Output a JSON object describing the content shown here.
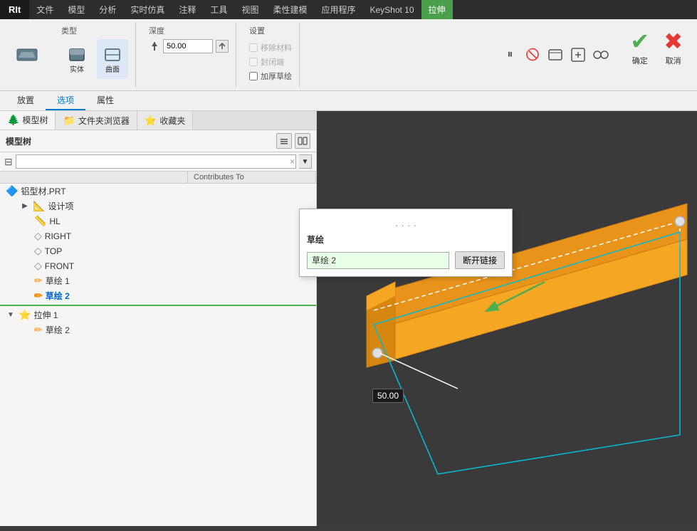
{
  "app": {
    "title": "RIt"
  },
  "menubar": {
    "items": [
      {
        "label": "文件",
        "active": false
      },
      {
        "label": "模型",
        "active": false
      },
      {
        "label": "分析",
        "active": false
      },
      {
        "label": "实时仿真",
        "active": false
      },
      {
        "label": "注释",
        "active": false
      },
      {
        "label": "工具",
        "active": false
      },
      {
        "label": "视图",
        "active": false
      },
      {
        "label": "柔性建模",
        "active": false
      },
      {
        "label": "应用程序",
        "active": false
      },
      {
        "label": "KeyShot 10",
        "active": false
      },
      {
        "label": "拉伸",
        "active": true,
        "highlight": true
      }
    ]
  },
  "ribbon": {
    "type_label": "类型",
    "depth_label": "深度",
    "settings_label": "设置",
    "solid_label": "实体",
    "surface_label": "曲面",
    "depth_value": "50.00",
    "remove_material_label": "移除材料",
    "close_ends_label": "封闭端",
    "thicken_sketch_label": "加厚草绘",
    "confirm_label": "确定",
    "cancel_label": "取消"
  },
  "subtabs": {
    "items": [
      {
        "label": "放置",
        "active": false
      },
      {
        "label": "选项",
        "active": true
      },
      {
        "label": "属性",
        "active": false
      }
    ]
  },
  "panel_tabs": [
    {
      "label": "模型树",
      "icon": "🌲",
      "active": true
    },
    {
      "label": "文件夹浏览器",
      "icon": "📁",
      "active": false
    },
    {
      "label": "收藏夹",
      "icon": "⭐",
      "active": false
    }
  ],
  "model_tree": {
    "title": "模型树",
    "search_placeholder": "",
    "contributes_to_label": "Contributes To",
    "items": [
      {
        "level": 0,
        "icon": "🔷",
        "label": "铝型材.PRT",
        "expandable": false
      },
      {
        "level": 1,
        "icon": "📐",
        "label": "设计项",
        "expandable": true
      },
      {
        "level": 1,
        "icon": "📏",
        "label": "HL",
        "expandable": false
      },
      {
        "level": 1,
        "icon": "📐",
        "label": "RIGHT",
        "expandable": false
      },
      {
        "level": 1,
        "icon": "📐",
        "label": "TOP",
        "expandable": false
      },
      {
        "level": 1,
        "icon": "📐",
        "label": "FRONT",
        "expandable": false
      },
      {
        "level": 1,
        "icon": "✏️",
        "label": "草绘 1",
        "expandable": false
      },
      {
        "level": 1,
        "icon": "✏️",
        "label": "草绘 2",
        "expandable": false,
        "active": true
      }
    ],
    "features": [
      {
        "level": 0,
        "icon": "⭐",
        "label": "拉伸 1",
        "expandable": true,
        "expanded": true
      },
      {
        "level": 1,
        "icon": "✏️",
        "label": "草绘 2",
        "expandable": false,
        "sub": true
      }
    ]
  },
  "sketch_panel": {
    "title": "草绘",
    "sketch_name": "草绘 2",
    "disconnect_btn": "断开链接"
  },
  "viewport": {
    "dimension_value": "50.00",
    "colors": {
      "background": "#3a3a3a",
      "model_fill": "#f5a623",
      "model_edge": "#e8941a",
      "sketch_outline": "#00bcd4",
      "axis_x": "#e53935",
      "axis_y": "#4caf50",
      "axis_z": "#2196f3",
      "handle_dot": "#e0e0e0",
      "green_arrow": "#4caf50",
      "white_line": "#ffffff"
    }
  }
}
